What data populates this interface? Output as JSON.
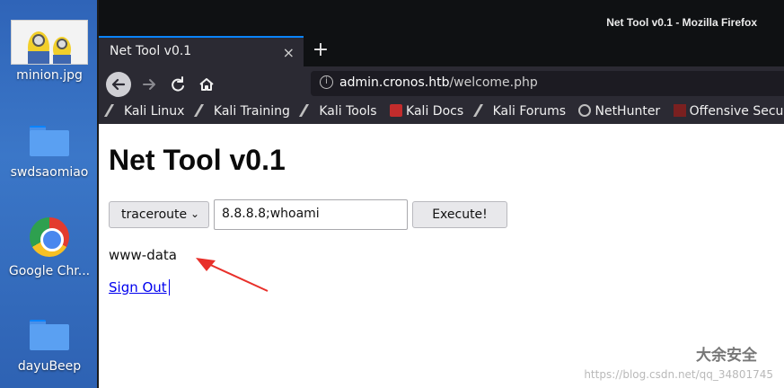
{
  "desktop": {
    "icons": [
      {
        "label": "minion.jpg",
        "icon": "image-thumbnail-icon"
      },
      {
        "label": "swdsaomiao",
        "icon": "folder-icon"
      },
      {
        "label": "Google Chr...",
        "icon": "chrome-icon"
      },
      {
        "label": "dayuBeep",
        "icon": "folder-icon"
      }
    ]
  },
  "window": {
    "title": "Net Tool v0.1 - Mozilla Firefox"
  },
  "tabs": [
    {
      "label": "Net Tool v0.1",
      "close": "×"
    }
  ],
  "newtab_label": "+",
  "url": {
    "domain": "admin.cronos.htb",
    "path": "/welcome.php"
  },
  "bookmarks": [
    {
      "label": "Kali Linux",
      "icon": "kali-dragon-icon"
    },
    {
      "label": "Kali Training",
      "icon": "kali-dragon-icon"
    },
    {
      "label": "Kali Tools",
      "icon": "kali-dragon-icon"
    },
    {
      "label": "Kali Docs",
      "icon": "kali-docs-icon"
    },
    {
      "label": "Kali Forums",
      "icon": "kali-dragon-icon"
    },
    {
      "label": "NetHunter",
      "icon": "nethunter-icon"
    },
    {
      "label": "Offensive Security",
      "icon": "offsec-icon"
    }
  ],
  "page": {
    "heading": "Net Tool v0.1",
    "select_value": "traceroute",
    "command_value": "8.8.8.8;whoami",
    "execute_label": "Execute!",
    "output": "www-data",
    "signout": "Sign Out"
  },
  "watermark": {
    "logo_text": "大余安全",
    "text": "https://blog.csdn.net/qq_34801745"
  },
  "colors": {
    "tab_accent": "#0a84ff",
    "annotation_arrow": "#e8302a",
    "link": "#0000ee"
  }
}
